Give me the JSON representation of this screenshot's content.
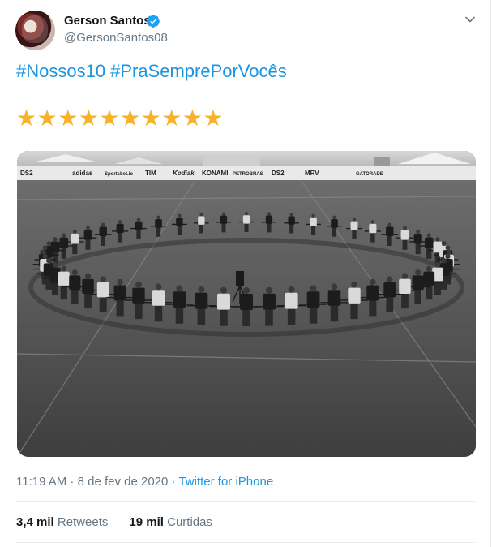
{
  "author": {
    "name": "Gerson Santos",
    "handle": "@GersonSantos08"
  },
  "tweet": {
    "hashtags": [
      "#Nossos10",
      "#PraSemprePorVocês"
    ],
    "stars": "★★★★★★★★★★",
    "star_color": "#f7b12a"
  },
  "image": {
    "ad_boards": [
      "DS2",
      "adidas",
      "Sportsbet.io",
      "TIM",
      "Kodiak",
      "KONAMI",
      "PETROBRAS",
      "DS2",
      "MRV",
      "GATORADE"
    ]
  },
  "meta": {
    "time": "11:19 AM",
    "separator": " · ",
    "date": "8 de fev de 2020",
    "source": "Twitter for iPhone"
  },
  "stats": {
    "retweets_count": "3,4 mil",
    "retweets_label": "Retweets",
    "likes_count": "19 mil",
    "likes_label": "Curtidas"
  },
  "colors": {
    "link": "#1b95e0",
    "muted": "#657786",
    "verified": "#1da1f2"
  }
}
